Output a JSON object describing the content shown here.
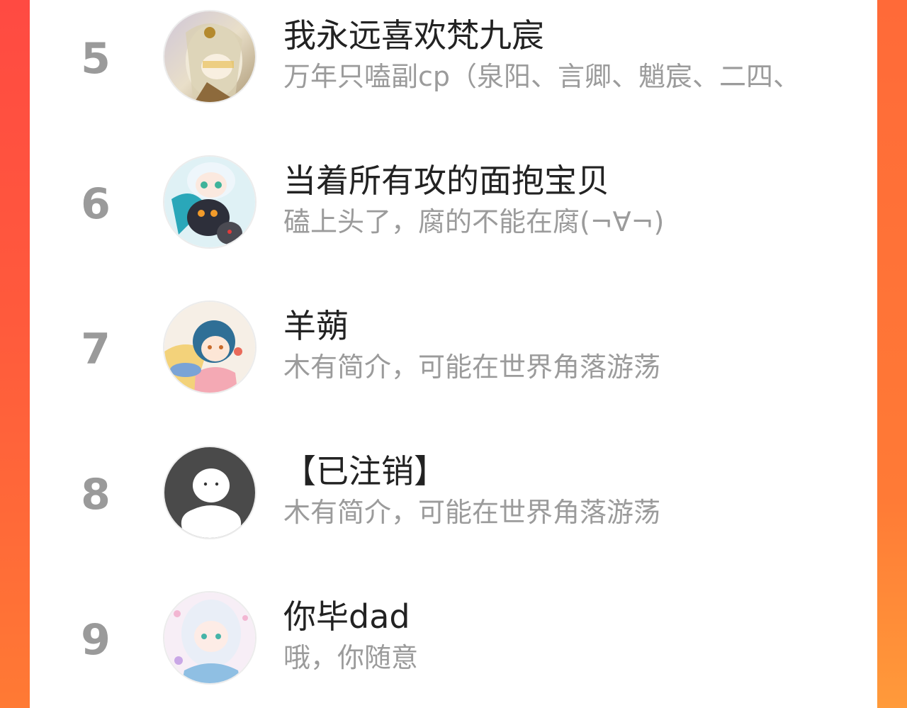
{
  "ranking": [
    {
      "rank": "5",
      "name": "我永远喜欢梵九宸",
      "desc": "万年只嗑副cp（泉阳、言卿、魈宸、二四、",
      "avatar": "anime-avatar-icon"
    },
    {
      "rank": "6",
      "name": "当着所有攻的面抱宝贝",
      "desc": "磕上头了，腐的不能在腐(¬∀¬)",
      "avatar": "anime-avatar-icon"
    },
    {
      "rank": "7",
      "name": "羊蒴",
      "desc": "木有简介，可能在世界角落游荡",
      "avatar": "anime-avatar-icon"
    },
    {
      "rank": "8",
      "name": "【已注销】",
      "desc": "木有简介，可能在世界角落游荡",
      "avatar": "default-user-icon"
    },
    {
      "rank": "9",
      "name": "你毕dad",
      "desc": "哦，你随意",
      "avatar": "anime-avatar-icon"
    }
  ],
  "colors": {
    "background_gradient_top": "#ff4a42",
    "background_gradient_bottom": "#ff7a34",
    "rank_color": "#9a9a9a",
    "name_color": "#222222",
    "desc_color": "#9b9b9b"
  }
}
